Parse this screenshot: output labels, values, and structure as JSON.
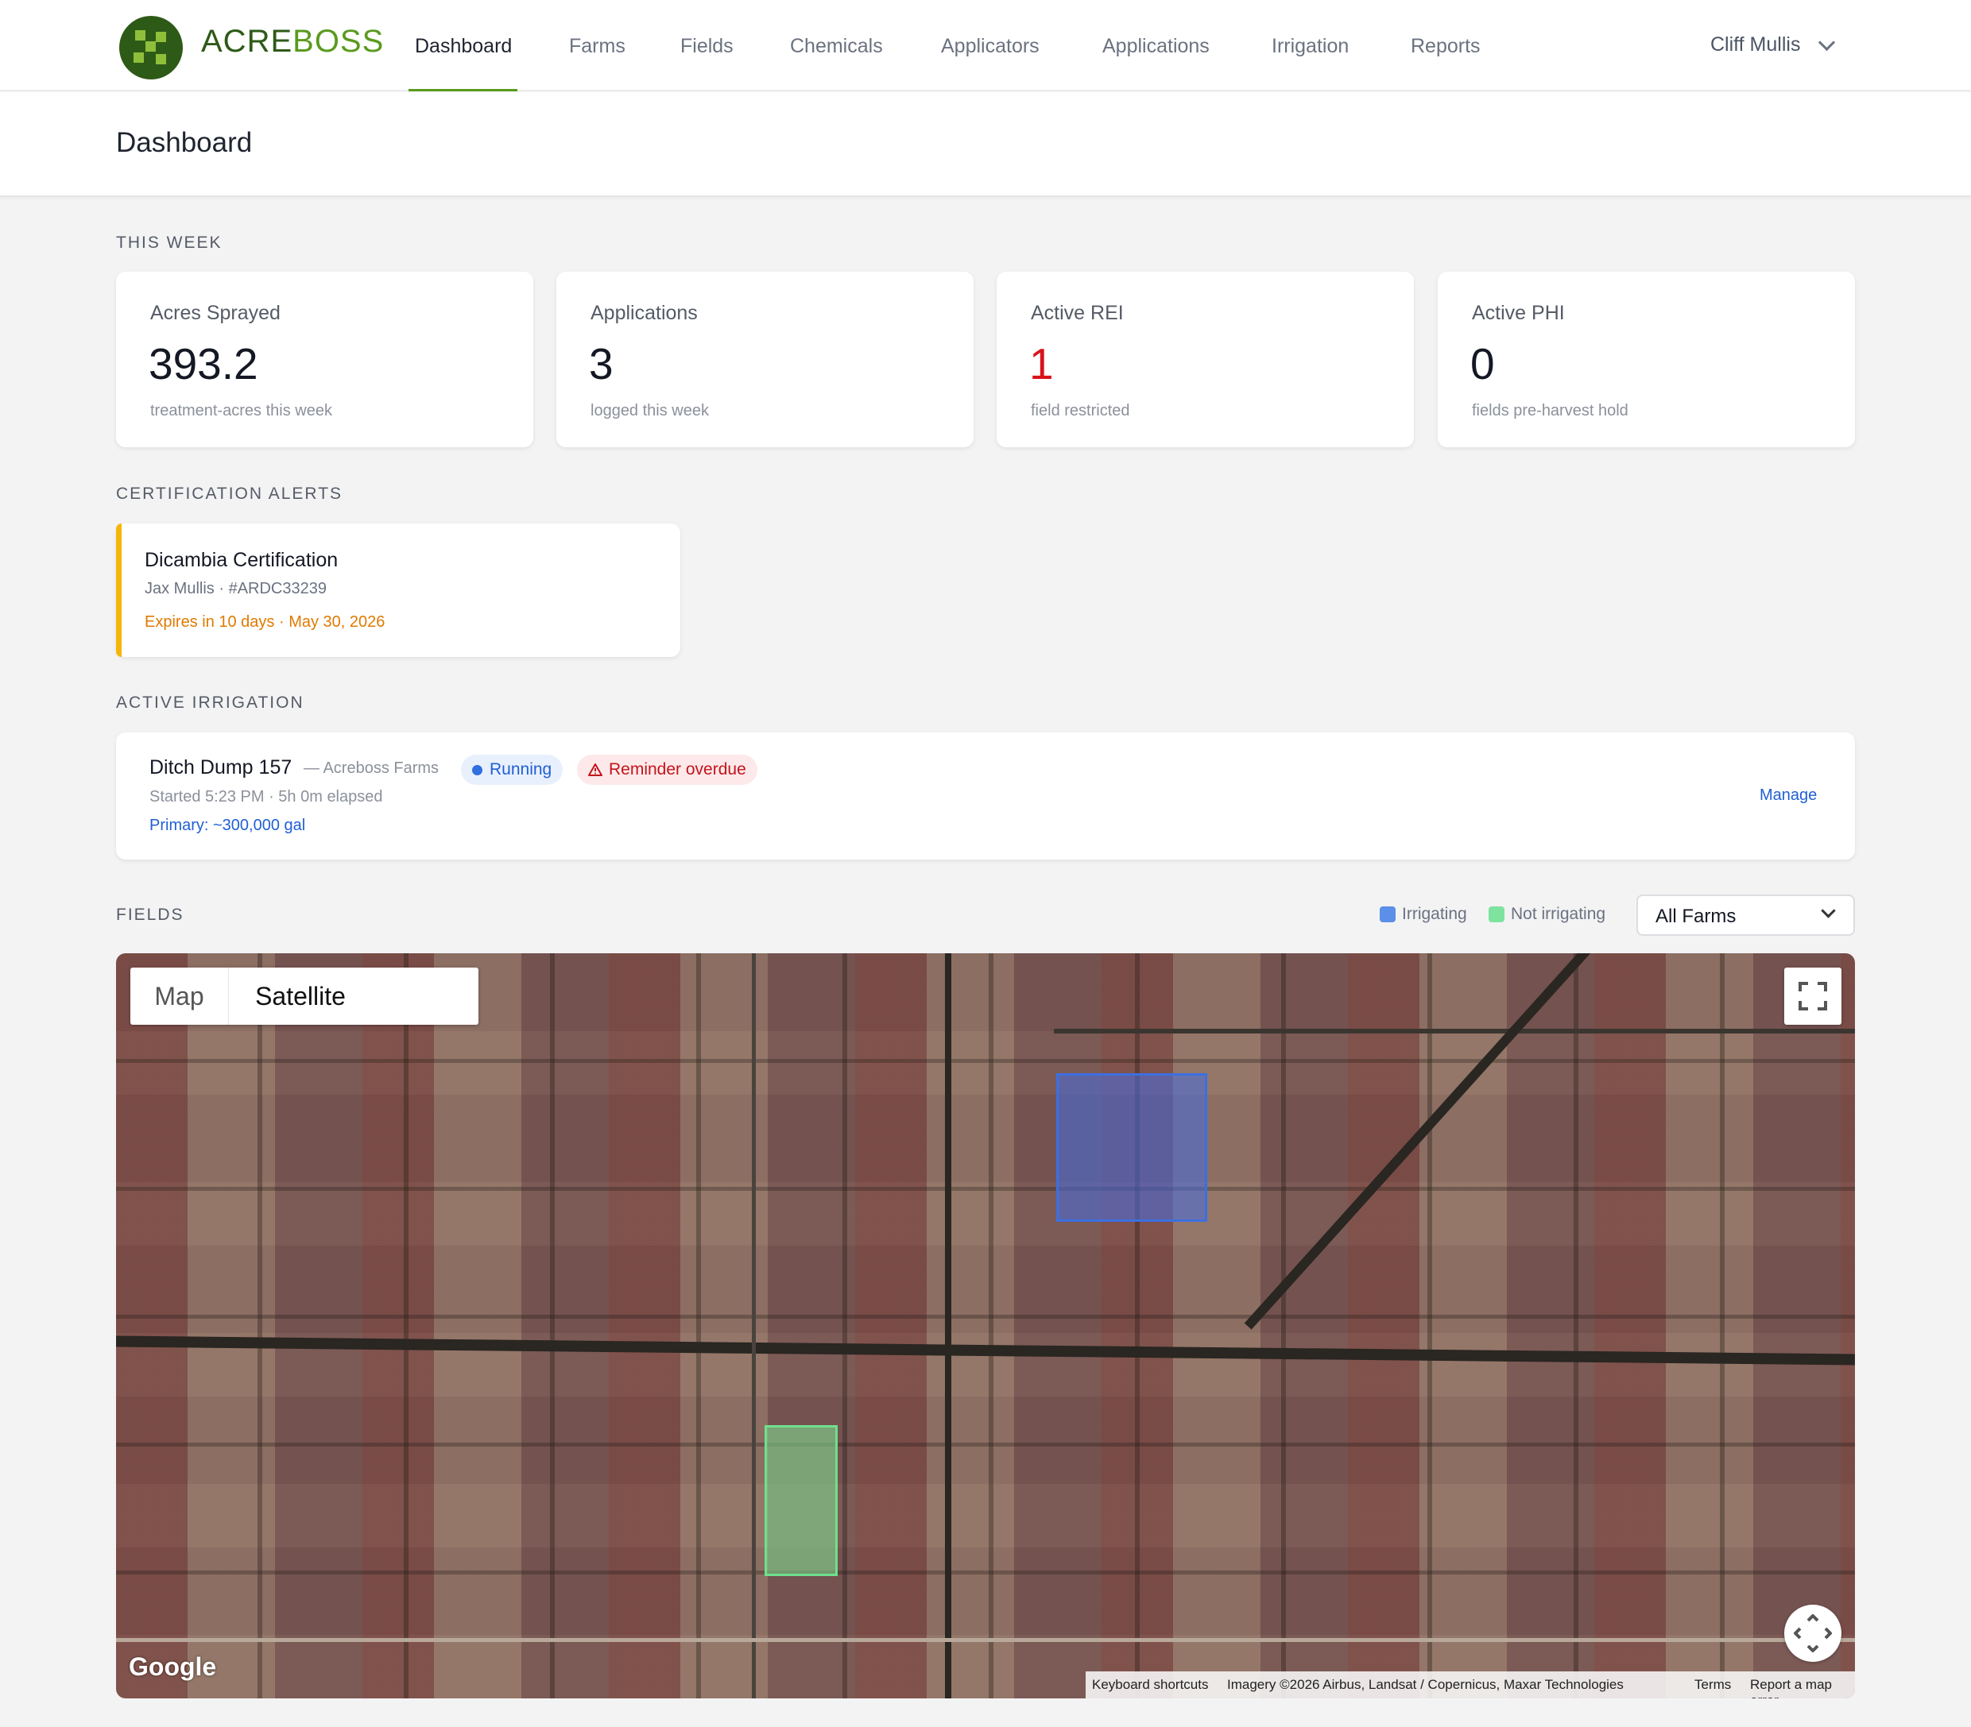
{
  "brand": {
    "name_part1": "ACRE",
    "name_part2": "BOSS"
  },
  "nav": {
    "items": [
      "Dashboard",
      "Farms",
      "Fields",
      "Chemicals",
      "Applicators",
      "Applications",
      "Irrigation",
      "Reports"
    ],
    "active": "Dashboard",
    "user": "Cliff Mullis"
  },
  "page": {
    "title": "Dashboard"
  },
  "this_week": {
    "label": "THIS WEEK",
    "stats": [
      {
        "label": "Acres Sprayed",
        "value": "393.2",
        "sub": "treatment-acres this week"
      },
      {
        "label": "Applications",
        "value": "3",
        "sub": "logged this week"
      },
      {
        "label": "Active REI",
        "value": "1",
        "sub": "field restricted",
        "value_color": "#d9121b"
      },
      {
        "label": "Active PHI",
        "value": "0",
        "sub": "fields pre-harvest hold"
      }
    ]
  },
  "cert_alerts": {
    "label": "CERTIFICATION ALERTS",
    "items": [
      {
        "title": "Dicambia Certification",
        "holder": "Jax Mullis · #ARDC33239",
        "expiry": "Expires in 10 days · May 30, 2026"
      }
    ]
  },
  "irrigation": {
    "label": "ACTIVE IRRIGATION",
    "items": [
      {
        "name": "Ditch Dump 157",
        "farm": "— Acreboss Farms",
        "status": "Running",
        "warning": "Reminder overdue",
        "started": "Started 5:23 PM · 5h 0m elapsed",
        "primary": "Primary: ~300,000 gal",
        "action": "Manage"
      }
    ]
  },
  "fields": {
    "label": "FIELDS",
    "legend": [
      {
        "label": "Irrigating",
        "color": "#5b8fe8"
      },
      {
        "label": "Not irrigating",
        "color": "#7fe3a0"
      }
    ],
    "farm_select": "All Farms",
    "map": {
      "type_buttons": [
        "Map",
        "Satellite"
      ],
      "active_type": "Satellite",
      "google": "Google",
      "attribution": [
        "Keyboard shortcuts",
        "Imagery ©2026 Airbus, Landsat / Copernicus, Maxar Technologies",
        "Terms",
        "Report a map error"
      ]
    }
  }
}
